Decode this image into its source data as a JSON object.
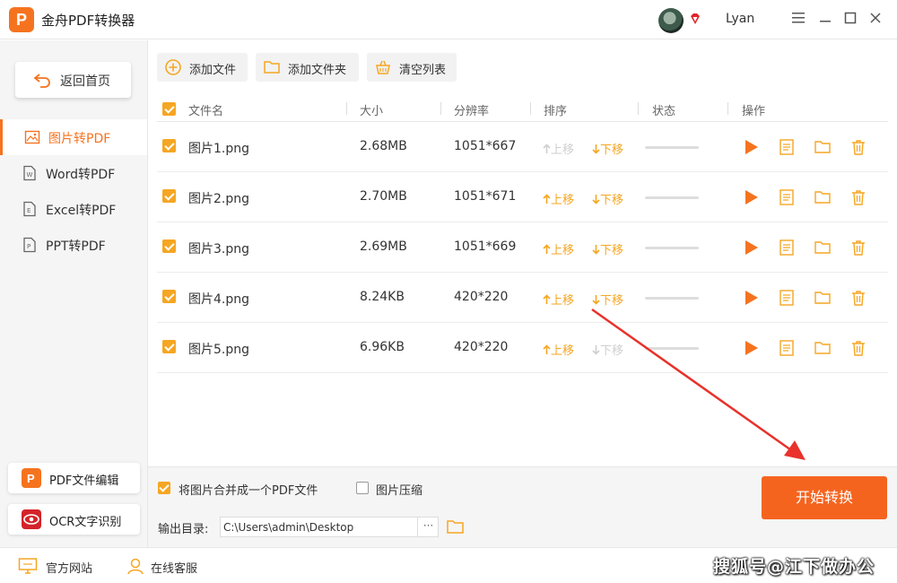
{
  "app": {
    "title": "金舟PDF转换器",
    "logo_letter": "P",
    "username": "Lyan"
  },
  "window": {
    "minimize": "☰",
    "min2": "—",
    "maximize": "☐",
    "close": "✕"
  },
  "sidebar": {
    "back_label": "返回首页",
    "items": [
      {
        "label": "图片转PDF",
        "icon": "image-icon",
        "active": true
      },
      {
        "label": "Word转PDF",
        "icon": "word-file-icon",
        "active": false
      },
      {
        "label": "Excel转PDF",
        "icon": "excel-file-icon",
        "active": false
      },
      {
        "label": "PPT转PDF",
        "icon": "ppt-file-icon",
        "active": false
      }
    ],
    "cards": [
      {
        "label": "PDF文件编辑",
        "icon": "pdf-edit-icon"
      },
      {
        "label": "OCR文字识别",
        "icon": "ocr-eye-icon"
      }
    ]
  },
  "toolbar": {
    "add_file": "添加文件",
    "add_folder": "添加文件夹",
    "clear_list": "清空列表"
  },
  "table": {
    "headers": {
      "filename": "文件名",
      "size": "大小",
      "resolution": "分辨率",
      "order": "排序",
      "status": "状态",
      "actions": "操作"
    },
    "move_up": "上移",
    "move_down": "下移",
    "rows": [
      {
        "name": "图片1.png",
        "size": "2.68MB",
        "res": "1051*667",
        "up_enabled": false,
        "down_enabled": true
      },
      {
        "name": "图片2.png",
        "size": "2.70MB",
        "res": "1051*671",
        "up_enabled": true,
        "down_enabled": true
      },
      {
        "name": "图片3.png",
        "size": "2.69MB",
        "res": "1051*669",
        "up_enabled": true,
        "down_enabled": true
      },
      {
        "name": "图片4.png",
        "size": "8.24KB",
        "res": "420*220",
        "up_enabled": true,
        "down_enabled": true
      },
      {
        "name": "图片5.png",
        "size": "6.96KB",
        "res": "420*220",
        "up_enabled": true,
        "down_enabled": false
      }
    ]
  },
  "options": {
    "merge_label": "将图片合并成一个PDF文件",
    "merge_checked": true,
    "compress_label": "图片压缩",
    "compress_checked": false,
    "output_label": "输出目录:",
    "output_path": "C:\\Users\\admin\\Desktop",
    "browse": "···"
  },
  "start_button": "开始转换",
  "footer": {
    "website": "官方网站",
    "support": "在线客服"
  },
  "watermark": "搜狐号@江下做办公",
  "colors": {
    "accent": "#f5731f",
    "check": "#f5a623",
    "start": "#f5641f",
    "arrow": "#e8322b"
  }
}
